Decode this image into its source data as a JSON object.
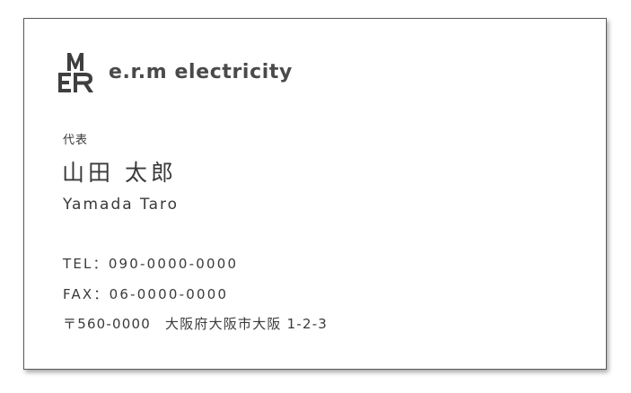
{
  "card": {
    "logo_letters": "MER",
    "company": "e.r.m electricity",
    "role": "代表",
    "name_family_ja": "山田",
    "name_given_ja": "太郎",
    "name_en": "Yamada Taro",
    "tel_label": "TEL：",
    "tel": "090-0000-0000",
    "fax_label": "FAX：",
    "fax": "06-0000-0000",
    "postal": "〒560-0000",
    "address": "大阪府大阪市大阪 1-2-3"
  },
  "colors": {
    "logo": "#3f3f3f",
    "text": "#3a3a3a",
    "border": "#5a5a5a"
  }
}
